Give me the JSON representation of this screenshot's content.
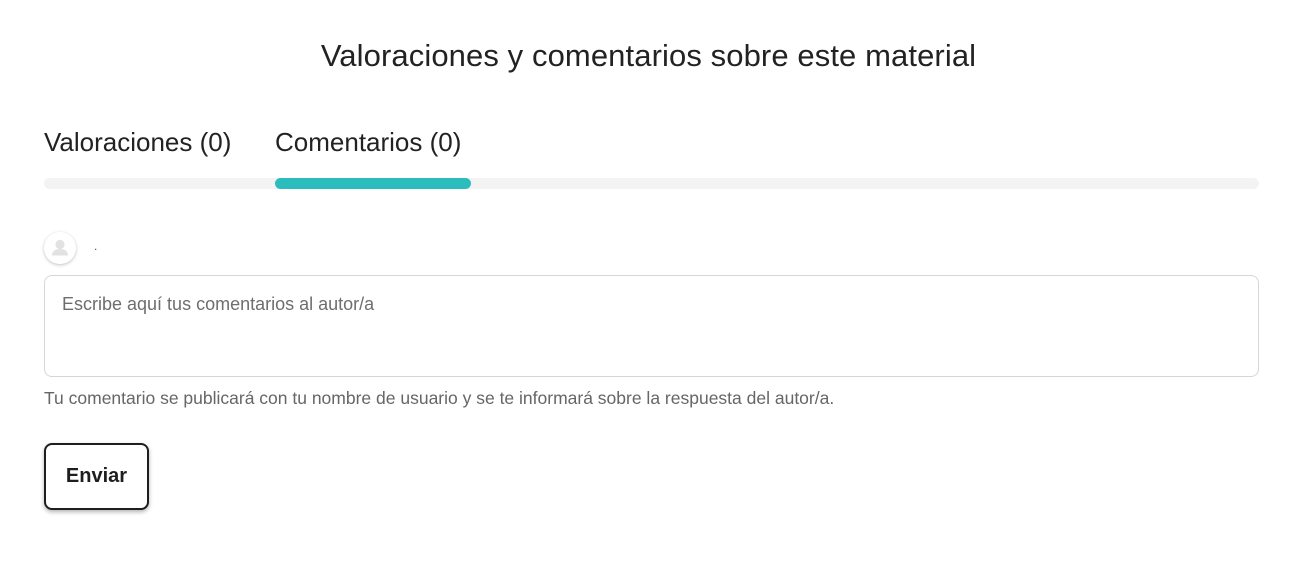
{
  "page": {
    "title": "Valoraciones y comentarios sobre este material"
  },
  "tabs": {
    "items": [
      {
        "label": "Valoraciones (0)",
        "active": false
      },
      {
        "label": "Comentarios (0)",
        "active": true
      }
    ]
  },
  "user": {
    "avatar_icon": "user-silhouette-icon",
    "name": "."
  },
  "comment": {
    "placeholder": "Escribe aquí tus comentarios al autor/a",
    "value": "",
    "helper": "Tu comentario se publicará con tu nombre de usuario y se te informará sobre la respuesta del autor/a."
  },
  "actions": {
    "submit_label": "Enviar"
  },
  "colors": {
    "accent": "#2bbdbd",
    "track": "#f3f3f3",
    "text": "#222222",
    "muted_text": "#666666",
    "border": "#d6d6d6"
  }
}
